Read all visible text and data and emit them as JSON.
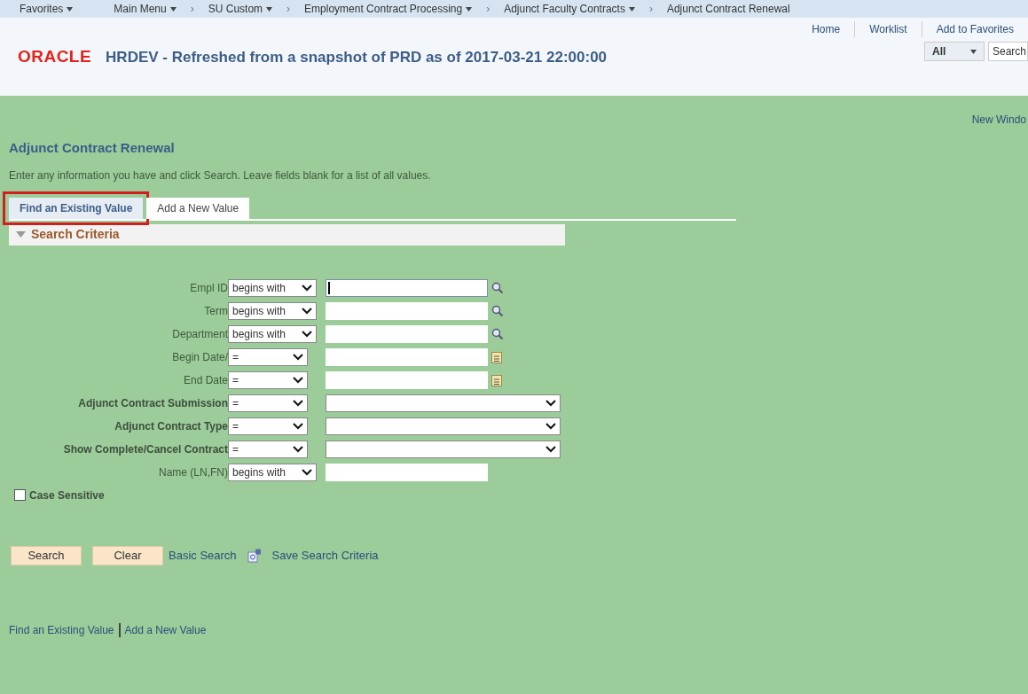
{
  "nav": {
    "items": [
      {
        "kind": "menu",
        "label": "Favorites"
      },
      {
        "kind": "menu",
        "label": "Main Menu"
      },
      {
        "kind": "separator",
        "label": "›"
      },
      {
        "kind": "menu",
        "label": "SU Custom"
      },
      {
        "kind": "separator",
        "label": "›"
      },
      {
        "kind": "menu",
        "label": "Employment Contract Processing"
      },
      {
        "kind": "separator",
        "label": "›"
      },
      {
        "kind": "menu",
        "label": "Adjunct Faculty Contracts"
      },
      {
        "kind": "separator",
        "label": "›"
      },
      {
        "kind": "page",
        "label": "Adjunct Contract Renewal"
      }
    ]
  },
  "header": {
    "logo": "ORACLE",
    "title": "HRDEV - Refreshed from a snapshot of PRD as of 2017-03-21 22:00:00",
    "links": [
      "Home",
      "Worklist",
      "Add to Favorites"
    ],
    "search_scope": "All",
    "search_button": "Search"
  },
  "new_window": "New Windo",
  "page_title": "Adjunct Contract Renewal",
  "instructions": "Enter any information you have and click Search. Leave fields blank for a list of all values.",
  "tabs": [
    {
      "label": "Find an Existing Value",
      "selected": true,
      "highlighted": true
    },
    {
      "label": "Add a New Value",
      "selected": false,
      "highlighted": false
    }
  ],
  "section": {
    "title": "Search Criteria",
    "expanded": true
  },
  "criteria": [
    {
      "label": "Empl ID",
      "bold": false,
      "kind": "lookup",
      "operator": "begins with",
      "focused": true
    },
    {
      "label": "Term",
      "bold": false,
      "kind": "lookup",
      "operator": "begins with",
      "focused": false
    },
    {
      "label": "Department",
      "bold": false,
      "kind": "lookup",
      "operator": "begins with",
      "focused": false
    },
    {
      "label": "Begin Date/",
      "bold": false,
      "kind": "date",
      "operator": "=",
      "focused": false
    },
    {
      "label": "End Date",
      "bold": false,
      "kind": "date",
      "operator": "=",
      "focused": false
    },
    {
      "label": "Adjunct Contract Submission",
      "bold": true,
      "kind": "select",
      "operator": "=",
      "focused": false
    },
    {
      "label": "Adjunct Contract Type",
      "bold": true,
      "kind": "select",
      "operator": "=",
      "focused": false
    },
    {
      "label": "Show Complete/Cancel Contract",
      "bold": true,
      "kind": "select",
      "operator": "=",
      "focused": false
    },
    {
      "label": "Name (LN,FN)",
      "bold": false,
      "kind": "text",
      "operator": "begins with",
      "focused": false
    }
  ],
  "case_sensitive": {
    "label": "Case Sensitive",
    "checked": false
  },
  "buttons": [
    "Search",
    "Clear"
  ],
  "links": [
    "Basic Search",
    "Save Search Criteria"
  ],
  "footer_links": [
    "Find an Existing Value",
    "Add a New Value"
  ]
}
